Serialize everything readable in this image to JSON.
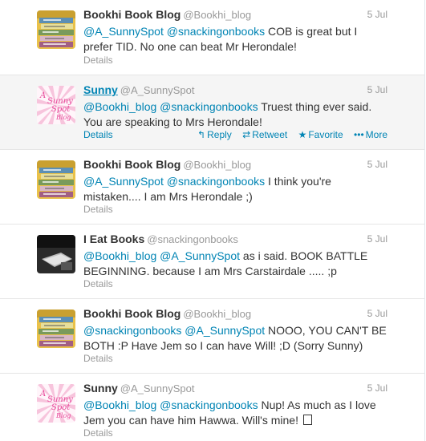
{
  "tweets": [
    {
      "fullname": "Bookhi Book Blog",
      "username": "@Bookhi_blog",
      "time": "5 Jul",
      "mention1": "@A_SunnySpot",
      "mention2": "@snackingonbooks",
      "text": "COB is great but I prefer TID. No one can beat Mr Herondale!",
      "details": "Details",
      "avatar": "book-stack-avatar"
    },
    {
      "fullname": "Sunny",
      "username": "@A_SunnySpot",
      "time": "5 Jul",
      "mention1": "@Bookhi_blog",
      "mention2": "@snackingonbooks",
      "text": "Truest thing ever said. You are speaking to Mrs Herondale!",
      "details": "Details",
      "avatar": "sunny-spot-blog-avatar",
      "actions": {
        "reply": "Reply",
        "retweet": "Retweet",
        "favorite": "Favorite",
        "more": "More"
      }
    },
    {
      "fullname": "Bookhi Book Blog",
      "username": "@Bookhi_blog",
      "time": "5 Jul",
      "mention1": "@A_SunnySpot",
      "mention2": "@snackingonbooks",
      "text": "I think you're mistaken.... I am Mrs Herondale ;)",
      "details": "Details",
      "avatar": "book-stack-avatar"
    },
    {
      "fullname": "I Eat Books",
      "username": "@snackingonbooks",
      "time": "5 Jul",
      "mention1": "@Bookhi_blog",
      "mention2": "@A_SunnySpot",
      "text": "as i said. BOOK BATTLE BEGINNING. because I am Mrs Carstairdale ..... ;p",
      "details": "Details",
      "avatar": "reading-photo-avatar"
    },
    {
      "fullname": "Bookhi Book Blog",
      "username": "@Bookhi_blog",
      "time": "5 Jul",
      "mention1": "@snackingonbooks",
      "mention2": "@A_SunnySpot",
      "text": "NOOO, YOU CAN'T BE BOTH :P Have Jem so I can have Will! ;D (Sorry Sunny)",
      "details": "Details",
      "avatar": "book-stack-avatar"
    },
    {
      "fullname": "Sunny",
      "username": "@A_SunnySpot",
      "time": "5 Jul",
      "mention1": "@Bookhi_blog",
      "mention2": "@snackingonbooks",
      "text": "Nup! As much as I love Jem you can have him Hawwa. Will's mine!",
      "details": "Details",
      "avatar": "sunny-spot-blog-avatar"
    }
  ],
  "avatar_logo": {
    "line1": "A",
    "line2": "Sunny",
    "line3": "Spot",
    "line4": "Blog"
  },
  "colors": {
    "link": "#0084b4",
    "meta": "#999999",
    "text": "#333333",
    "hover_bg": "#f5f5f5",
    "sunny_pink": "#e8489a"
  }
}
